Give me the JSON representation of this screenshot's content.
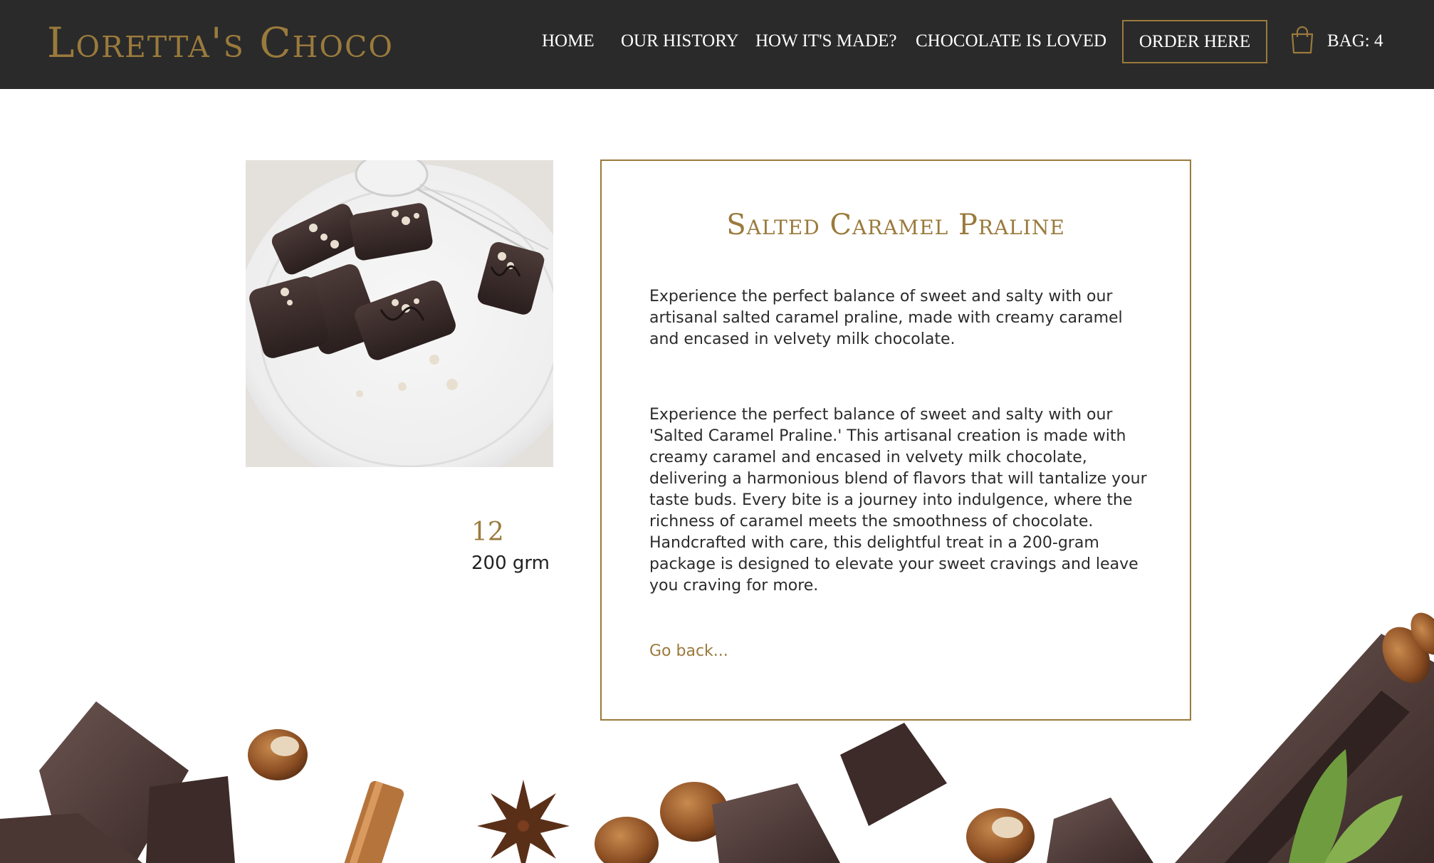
{
  "header": {
    "logo": "Loretta's Choco",
    "nav": [
      {
        "label": "HOME"
      },
      {
        "label": "OUR HISTORY"
      },
      {
        "label": "HOW IT'S MADE?"
      },
      {
        "label": "CHOCOLATE IS LOVED"
      }
    ],
    "order_button": "ORDER HERE",
    "bag_label": "BAG: 4",
    "bag_icon": "shopping-bag-icon"
  },
  "product": {
    "title": "Salted Caramel Praline",
    "pieces": "12",
    "weight": "200 grm",
    "description_short": "Experience the perfect balance of sweet and salty with our artisanal salted caramel praline, made with creamy caramel and encased in velvety milk chocolate.",
    "description_long": "Experience the perfect balance of sweet and salty with our 'Salted Caramel Praline.' This artisanal creation is made with creamy caramel and encased in velvety milk chocolate, delivering a harmonious blend of flavors that will tantalize your taste buds. Every bite is a journey into indulgence, where the richness of caramel meets the smoothness of chocolate. Handcrafted with care, this delightful treat in a 200-gram package is designed to elevate your sweet cravings and leave you craving for more.",
    "go_back": "Go back..."
  },
  "colors": {
    "header_bg": "#2a2a2a",
    "accent_gold": "#9a7a3c",
    "text_dark": "#2b2b2b"
  }
}
